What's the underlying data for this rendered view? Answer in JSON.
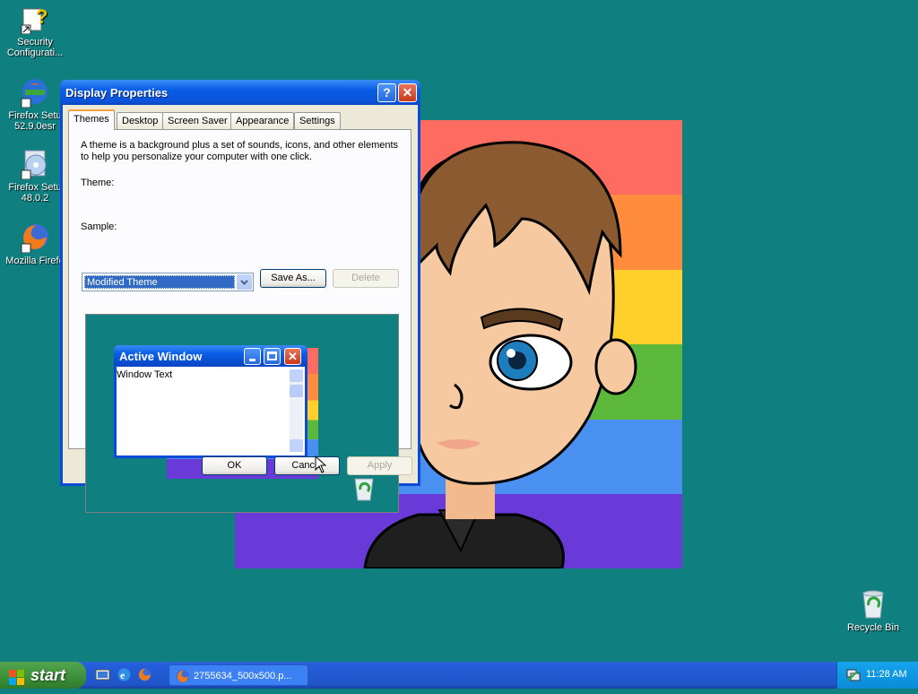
{
  "desktop": {
    "icons": [
      {
        "label": "Security Configurati...",
        "icon": "security-config-icon"
      },
      {
        "label": "Firefox Setu 52.9.0esr",
        "icon": "firefox-setup-icon"
      },
      {
        "label": "Firefox Setu 48.0.2",
        "icon": "setup-cd-icon"
      },
      {
        "label": "Mozilla Firefo",
        "icon": "firefox-icon"
      }
    ],
    "recycle_bin": {
      "label": "Recycle Bin"
    },
    "background_color": "#0f7f80"
  },
  "wallpaper_stripes": [
    "#fe6b60",
    "#ff8b3d",
    "#ffd02b",
    "#5cb83b",
    "#4a90f0",
    "#6a3ad8"
  ],
  "dialog": {
    "title": "Display Properties",
    "help_button": "?",
    "tabs": [
      "Themes",
      "Desktop",
      "Screen Saver",
      "Appearance",
      "Settings"
    ],
    "active_tab": "Themes",
    "description": "A theme is a background plus a set of sounds, icons, and other elements to help you personalize your computer with one click.",
    "theme_label": "Theme:",
    "theme_value": "Modified Theme",
    "save_as": "Save As...",
    "delete": "Delete",
    "sample_label": "Sample:",
    "preview": {
      "window_title": "Active Window",
      "window_text": "Window Text"
    },
    "ok": "OK",
    "cancel": "Cancel",
    "apply": "Apply"
  },
  "taskbar": {
    "start": "start",
    "quick_launch": [
      "show-desktop-icon",
      "ie-icon",
      "firefox-icon"
    ],
    "task_button": "2755634_500x500.p...",
    "clock": "11:28 AM"
  }
}
